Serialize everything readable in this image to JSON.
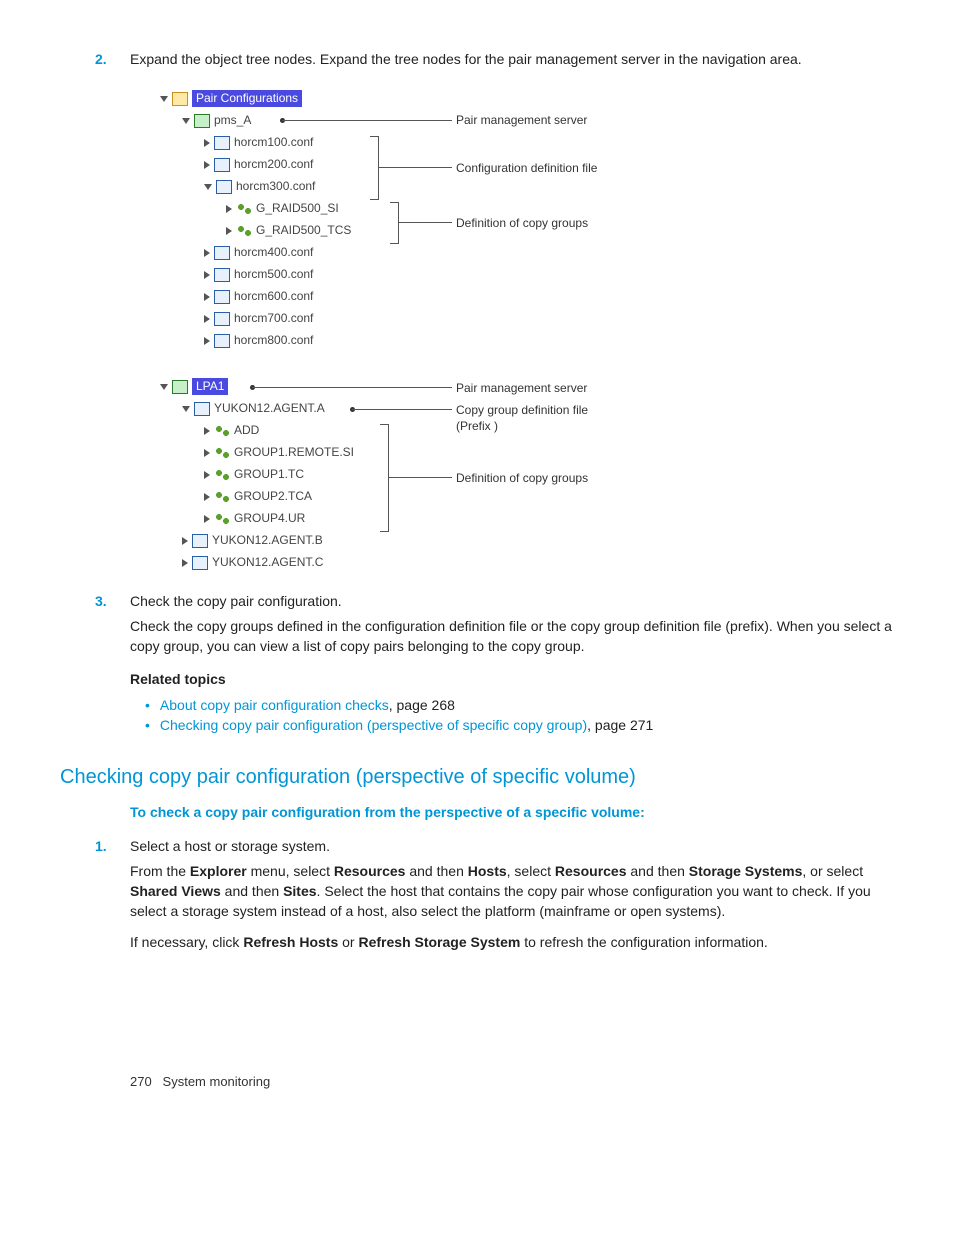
{
  "steps_top": {
    "s2_num": "2.",
    "s2_text": "Expand the object tree nodes. Expand the tree nodes for the pair management server in the navigation area.",
    "s3_num": "3.",
    "s3_text": "Check the copy pair configuration.",
    "s3_sub": "Check the copy groups defined in the configuration definition file or the copy group definition file (prefix). When you select a copy group, you can view a list of copy pairs belonging to the copy group."
  },
  "tree1": {
    "root": "Pair Configurations",
    "pms": "pms_A",
    "files": [
      "horcm100.conf",
      "horcm200.conf",
      "horcm300.conf",
      "horcm400.conf",
      "horcm500.conf",
      "horcm600.conf",
      "horcm700.conf",
      "horcm800.conf"
    ],
    "groups": [
      "G_RAID500_SI",
      "G_RAID500_TCS"
    ]
  },
  "callouts1": {
    "pms": "Pair management server",
    "cdf": "Configuration definition file",
    "dcg": "Definition of copy groups"
  },
  "tree2": {
    "root": "LPA1",
    "agentA": "YUKON12.AGENT.A",
    "groups": [
      "ADD",
      "GROUP1.REMOTE.SI",
      "GROUP1.TC",
      "GROUP2.TCA",
      "GROUP4.UR"
    ],
    "agentB": "YUKON12.AGENT.B",
    "agentC": "YUKON12.AGENT.C"
  },
  "callouts2": {
    "pms": "Pair management server",
    "cgdf": "Copy group definition file (Prefix )",
    "dcg": "Definition of copy groups"
  },
  "related": {
    "heading": "Related topics",
    "l1_a": "About copy pair configuration checks",
    "l1_p": ", page 268",
    "l2_a": "Checking copy pair configuration (perspective of specific copy group)",
    "l2_p": ", page 271"
  },
  "section2": {
    "heading": "Checking copy pair configuration (perspective of specific volume)",
    "prochead": "To check a copy pair configuration from the perspective of a specific volume:",
    "s1_num": "1.",
    "s1_text": "Select a host or storage system.",
    "s1_p1a": "From the ",
    "s1_p1b": "Explorer",
    "s1_p1c": " menu, select ",
    "s1_p1d": "Resources",
    "s1_p1e": " and then ",
    "s1_p1f": "Hosts",
    "s1_p1g": ", select ",
    "s1_p1h": "Resources",
    "s1_p1i": " and then ",
    "s1_p1j": "Storage Systems",
    "s1_p1k": ", or select ",
    "s1_p1l": "Shared Views",
    "s1_p1m": " and then ",
    "s1_p1n": "Sites",
    "s1_p1o": ". Select the host that contains the copy pair whose configuration you want to check. If you select a storage system instead of a host, also select the platform (mainframe or open systems).",
    "s1_p2a": "If necessary, click ",
    "s1_p2b": "Refresh Hosts",
    "s1_p2c": " or ",
    "s1_p2d": "Refresh Storage System",
    "s1_p2e": " to refresh the configuration information."
  },
  "footer": {
    "page": "270",
    "title": "System monitoring"
  }
}
